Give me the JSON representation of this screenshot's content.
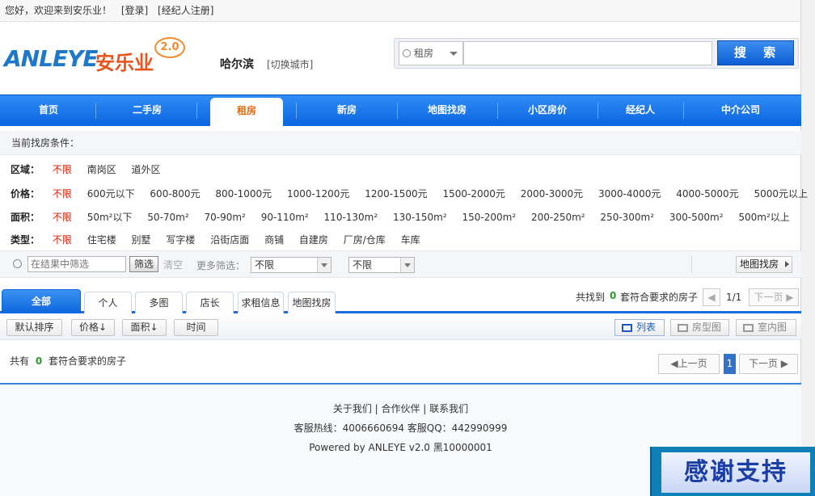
{
  "topbar": {
    "greeting": "您好，欢迎来到安乐业！",
    "login": "[登录]",
    "register": "[经纪人注册]"
  },
  "logo": {
    "en": "ANLEYE",
    "cn": "安乐业",
    "version": "2.0"
  },
  "city": {
    "name": "哈尔滨",
    "switch": "[切换城市]"
  },
  "search": {
    "category": "租房",
    "button": "搜 索",
    "value": ""
  },
  "nav": {
    "items": [
      {
        "label": "首页"
      },
      {
        "label": "二手房"
      },
      {
        "label": "租房",
        "active": true
      },
      {
        "label": "新房"
      },
      {
        "label": "地图找房"
      },
      {
        "label": "小区房价"
      },
      {
        "label": "经纪人"
      },
      {
        "label": "中介公司"
      }
    ]
  },
  "filters": {
    "heading": "当前找房条件：",
    "region": {
      "label": "区域：",
      "options": [
        "不限",
        "南岗区",
        "道外区"
      ]
    },
    "price": {
      "label": "价格：",
      "options": [
        "不限",
        "600元以下",
        "600-800元",
        "800-1000元",
        "1000-1200元",
        "1200-1500元",
        "1500-2000元",
        "2000-3000元",
        "3000-4000元",
        "4000-5000元",
        "5000元以上"
      ]
    },
    "area": {
      "label": "面积：",
      "options": [
        "不限",
        "50m²以下",
        "50-70m²",
        "70-90m²",
        "90-110m²",
        "110-130m²",
        "130-150m²",
        "150-200m²",
        "200-250m²",
        "250-300m²",
        "300-500m²",
        "500m²以上"
      ]
    },
    "type": {
      "label": "类型：",
      "options": [
        "不限",
        "住宅楼",
        "别墅",
        "写字楼",
        "沿街店面",
        "商铺",
        "自建房",
        "厂房/仓库",
        "车库"
      ]
    }
  },
  "searchbar": {
    "placeholder": "在结果中筛选",
    "filter_btn": "筛选",
    "clear": "清空",
    "more": "更多筛选：",
    "select1": "不限",
    "select2": "不限",
    "map": "地图找房"
  },
  "tabs": {
    "items": [
      "全部",
      "个人",
      "多图",
      "店长",
      "求租信息",
      "地图找房"
    ]
  },
  "results_header": {
    "prefix": "共找到",
    "count": "0",
    "suffix": "套符合要求的房子",
    "page": "1/1",
    "next": "下一页"
  },
  "sort": {
    "items": [
      "默认排序",
      "价格↓",
      "面积↓",
      "时间"
    ],
    "views": [
      "列表",
      "房型图",
      "室内图"
    ]
  },
  "results": {
    "prefix": "共有",
    "count": "0",
    "suffix": "套符合要求的房子",
    "prev": "上一页",
    "current": "1",
    "next": "下一页"
  },
  "footer": {
    "links": "关于我们 | 合作伙伴 | 联系我们",
    "hotline": "客服热线：4006660694 客服QQ：442990999",
    "powered": "Powered by ANLEYE v2.0 黑10000001"
  },
  "badge": {
    "text": "感谢支持"
  },
  "colors": {
    "accent": "#0b66e0",
    "highlight": "#e56a0e",
    "red": "#d81e06",
    "count": "#2e9a2e"
  }
}
